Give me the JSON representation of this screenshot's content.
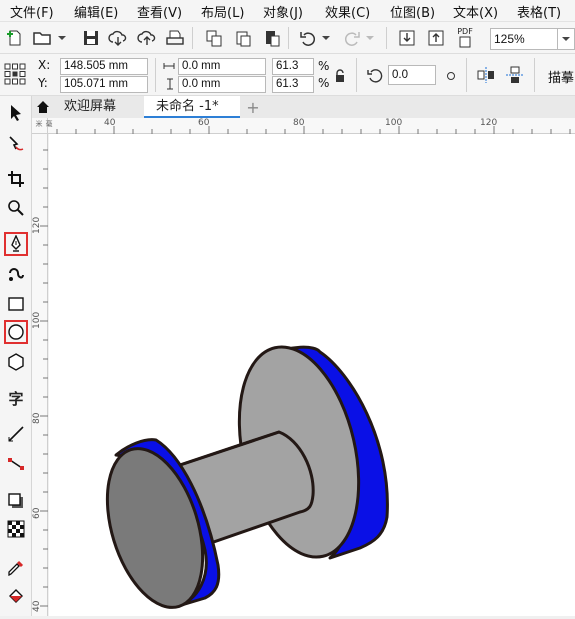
{
  "menu": [
    "文件(F)",
    "编辑(E)",
    "查看(V)",
    "布局(L)",
    "对象(J)",
    "效果(C)",
    "位图(B)",
    "文本(X)",
    "表格(T)"
  ],
  "toolbar": {
    "zoom_value": "125%",
    "pdf_label": "PDF"
  },
  "props": {
    "x_label": "X:",
    "y_label": "Y:",
    "x_value": "148.505 mm",
    "y_value": "105.071 mm",
    "w_value": "0.0 mm",
    "h_value": "0.0 mm",
    "sx_value": "61.3",
    "sy_value": "61.3",
    "pct1": "%",
    "pct2": "%",
    "rotation_value": "0.0",
    "trace_label": "描摹"
  },
  "tabs": [
    {
      "label": "欢迎屏幕",
      "active": false
    },
    {
      "label": "未命名 -1*",
      "active": true
    }
  ],
  "add_tab_glyph": "+",
  "ruler": {
    "top": [
      "40",
      "60",
      "80",
      "100",
      "120"
    ],
    "left": [
      "120",
      "100",
      "80",
      "60",
      "40"
    ],
    "corner": "毫米"
  },
  "tools": [
    "pick-tool",
    "shape-tool",
    "crop-tool",
    "zoom-tool",
    "pen-tool",
    "artistic-media-tool",
    "rectangle-tool",
    "ellipse-tool",
    "polygon-tool",
    "text-tool",
    "dimension-tool",
    "connector-tool",
    "drop-shadow-tool",
    "transparency-tool",
    "eyedropper-tool",
    "fill-tool"
  ],
  "text_tool_glyph": "字",
  "highlighted_tools": [
    "pen-tool",
    "ellipse-tool"
  ],
  "colors": {
    "blue_rim": "#0a10e6",
    "gray_face": "#a3a3a3",
    "dark_face": "#7a7a7a",
    "outline": "#231815",
    "highlight": "#e03030"
  }
}
